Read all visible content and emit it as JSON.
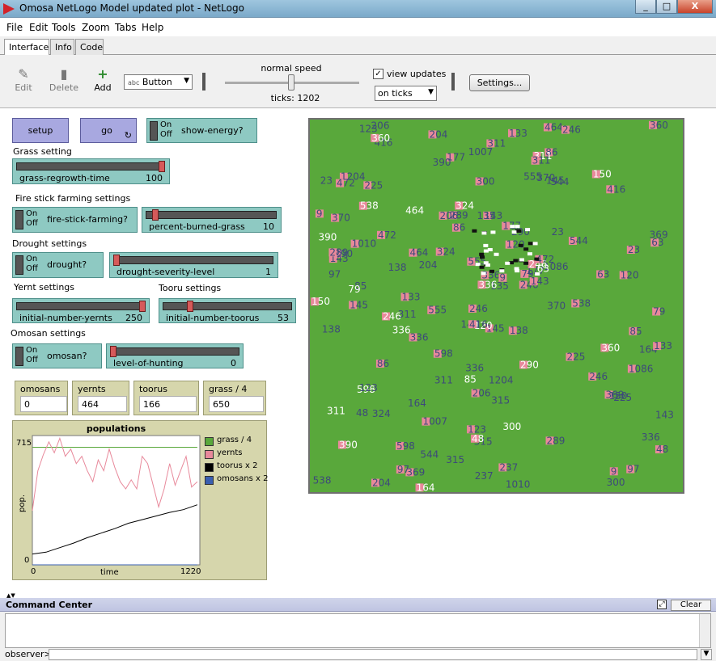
{
  "window": {
    "title": "Omosa NetLogo Model updated plot - NetLogo",
    "minimize": "_",
    "maximize": "□",
    "close": "X"
  },
  "menu": [
    "File",
    "Edit",
    "Tools",
    "Zoom",
    "Tabs",
    "Help"
  ],
  "tabs": [
    "Interface",
    "Info",
    "Code"
  ],
  "toolbar": {
    "edit": "Edit",
    "delete": "Delete",
    "add": "Add",
    "widget_type": "Button",
    "speed_label": "normal speed",
    "ticks": "ticks: 1202",
    "view_updates": "view updates",
    "update_mode": "on ticks",
    "settings": "Settings..."
  },
  "buttons": {
    "setup": "setup",
    "go": "go"
  },
  "switch_on": "On",
  "switch_off": "Off",
  "switches": {
    "show_energy": "show-energy?",
    "fire_stick": "fire-stick-farming?",
    "drought": "drought?",
    "omosan": "omosan?"
  },
  "sections": {
    "grass": "Grass setting",
    "fire": "Fire stick farming settings",
    "drought": "Drought settings",
    "yernt": "Yernt settings",
    "tooru": "Tooru settings",
    "omosan": "Omosan settings"
  },
  "sliders": {
    "grass_regrowth": {
      "name": "grass-regrowth-time",
      "value": "100",
      "level": 1.0
    },
    "percent_burned": {
      "name": "percent-burned-grass",
      "value": "10",
      "level": 0.05
    },
    "drought_severity": {
      "name": "drought-severity-level",
      "value": "1",
      "level": 0.0
    },
    "init_yernts": {
      "name": "initial-number-yernts",
      "value": "250",
      "level": 1.0
    },
    "init_toorus": {
      "name": "initial-number-toorus",
      "value": "53",
      "level": 0.2
    },
    "hunting": {
      "name": "level-of-hunting",
      "value": "0",
      "level": 0.0
    }
  },
  "monitors": [
    {
      "label": "omosans",
      "value": "0"
    },
    {
      "label": "yernts",
      "value": "464"
    },
    {
      "label": "toorus",
      "value": "166"
    },
    {
      "label": "grass / 4",
      "value": "650"
    }
  ],
  "plot": {
    "title": "populations",
    "ylabel": "pop.",
    "xlabel": "time",
    "ymax_label": "715",
    "ymin_label": "0",
    "xmin_label": "0",
    "xmax_label": "1220",
    "legend": [
      {
        "name": "grass / 4",
        "color": "#59a83b"
      },
      {
        "name": "yernts",
        "color": "#e8899b"
      },
      {
        "name": "toorus x 2",
        "color": "#000000"
      },
      {
        "name": "omosans x 2",
        "color": "#3a5fb0"
      }
    ]
  },
  "chart_data": {
    "type": "line",
    "title": "populations",
    "xlabel": "time",
    "ylabel": "pop.",
    "xlim": [
      0,
      1220
    ],
    "ylim": [
      0,
      715
    ],
    "series": [
      {
        "name": "grass / 4",
        "color": "#59a83b",
        "x": [
          0,
          1202
        ],
        "values": [
          650,
          650
        ]
      },
      {
        "name": "yernts",
        "color": "#e8899b",
        "x": [
          0,
          40,
          80,
          120,
          160,
          200,
          240,
          280,
          320,
          360,
          400,
          440,
          480,
          520,
          560,
          600,
          640,
          680,
          720,
          760,
          800,
          840,
          880,
          920,
          960,
          1000,
          1040,
          1080,
          1120,
          1160,
          1202
        ],
        "values": [
          300,
          520,
          610,
          680,
          620,
          700,
          600,
          640,
          560,
          600,
          520,
          460,
          580,
          520,
          640,
          540,
          460,
          420,
          470,
          420,
          600,
          560,
          440,
          320,
          420,
          560,
          440,
          520,
          600,
          430,
          460
        ]
      },
      {
        "name": "toorus x 2",
        "color": "#000000",
        "x": [
          0,
          100,
          200,
          300,
          400,
          500,
          600,
          700,
          800,
          900,
          1000,
          1100,
          1202
        ],
        "values": [
          60,
          70,
          95,
          120,
          150,
          175,
          200,
          230,
          250,
          270,
          290,
          305,
          332
        ]
      },
      {
        "name": "omosans x 2",
        "color": "#3a5fb0",
        "x": [
          0,
          1202
        ],
        "values": [
          0,
          0
        ]
      }
    ]
  },
  "world_labels": [
    "145",
    "246",
    "79",
    "86",
    "544",
    "416",
    "85",
    "143",
    "204",
    "120",
    "324",
    "598",
    "177",
    "538",
    "97",
    "63",
    "123",
    "464",
    "164",
    "336",
    "133",
    "138",
    "369",
    "246",
    "315",
    "48",
    "23",
    "289",
    "360",
    "300",
    "311",
    "290",
    "150",
    "311",
    "336",
    "206",
    "225",
    "390",
    "472",
    "555",
    "9",
    "370",
    "237",
    "1204",
    "1010",
    "1007",
    "1086",
    "135",
    "143"
  ],
  "command_center": {
    "title": "Command Center",
    "clear": "Clear",
    "prompt": "observer>"
  }
}
